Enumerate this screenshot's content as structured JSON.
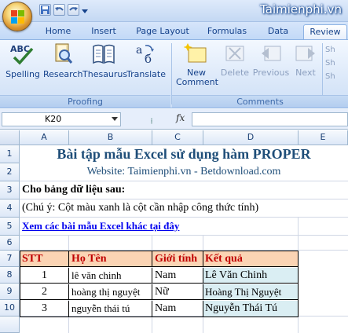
{
  "watermark": "Taimienphi.vn",
  "tabs": [
    "Home",
    "Insert",
    "Page Layout",
    "Formulas",
    "Data",
    "Review"
  ],
  "ribbon": {
    "proofing": {
      "label": "Proofing",
      "spelling": "Spelling",
      "research": "Research",
      "thesaurus": "Thesaurus",
      "translate": "Translate"
    },
    "comments": {
      "label": "Comments",
      "new_comment_1": "New",
      "new_comment_2": "Comment",
      "delete": "Delete",
      "previous": "Previous",
      "next": "Next"
    },
    "partial": [
      "Sh",
      "Sh",
      "Sh"
    ]
  },
  "namebox": {
    "value": "K20",
    "fx": "fx"
  },
  "columns": [
    "A",
    "B",
    "C",
    "D",
    "E"
  ],
  "rows": [
    "1",
    "2",
    "3",
    "4",
    "5",
    "6",
    "7",
    "8",
    "9",
    "10"
  ],
  "sheet": {
    "title": "Bài tập mẫu Excel sử dụng hàm PROPER",
    "website": "Website: Taimienphi.vn - Betdownload.com",
    "intro": "Cho bảng dữ liệu sau:",
    "note": "(Chú ý: Cột màu xanh là cột cần nhập công thức tính)",
    "link": "Xem các bài mẫu Excel khác tại đây",
    "table": {
      "headers": [
        "STT",
        "Họ Tên",
        "Giới tính",
        "Kết quả"
      ],
      "rows": [
        [
          "1",
          "lê văn chinh",
          "Nam",
          "Lê Văn Chinh"
        ],
        [
          "2",
          "hoàng thị nguyệt",
          "Nữ",
          "Hoàng Thị Nguyệt"
        ],
        [
          "3",
          "nguyễn thái tú",
          "Nam",
          "Nguyễn Thái Tú"
        ]
      ]
    }
  },
  "colors": {
    "header_fill": "#fbd4b4",
    "result_fill": "#daeef3",
    "title": "#1f4e79",
    "header_text": "#c00000",
    "link": "#0000ee"
  }
}
